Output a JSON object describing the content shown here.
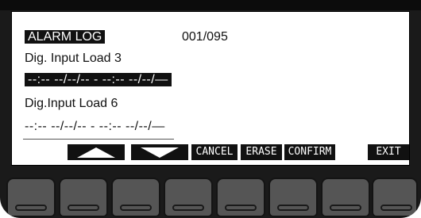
{
  "screen": {
    "title": "ALARM LOG",
    "counter": "001/095",
    "entries": [
      {
        "label": "Dig. Input Load 3",
        "timestamp": "--:-- --/--/--  - --:-- --/--/—",
        "selected": true
      },
      {
        "label": "Dig.Input Load 6",
        "timestamp": "--:-- --/--/--  - --:-- --/--/—",
        "selected": false
      }
    ]
  },
  "softkeys": {
    "up_icon": "triangle-up-icon",
    "down_icon": "triangle-down-icon",
    "cancel": "CANCEL",
    "erase": "ERASE",
    "confirm": "CONFIRM",
    "exit": "EXIT"
  },
  "colors": {
    "bezel": "#1a1a1a",
    "lcd_background": "#ffffff",
    "lcd_ink": "#111111",
    "key": "#555555"
  }
}
